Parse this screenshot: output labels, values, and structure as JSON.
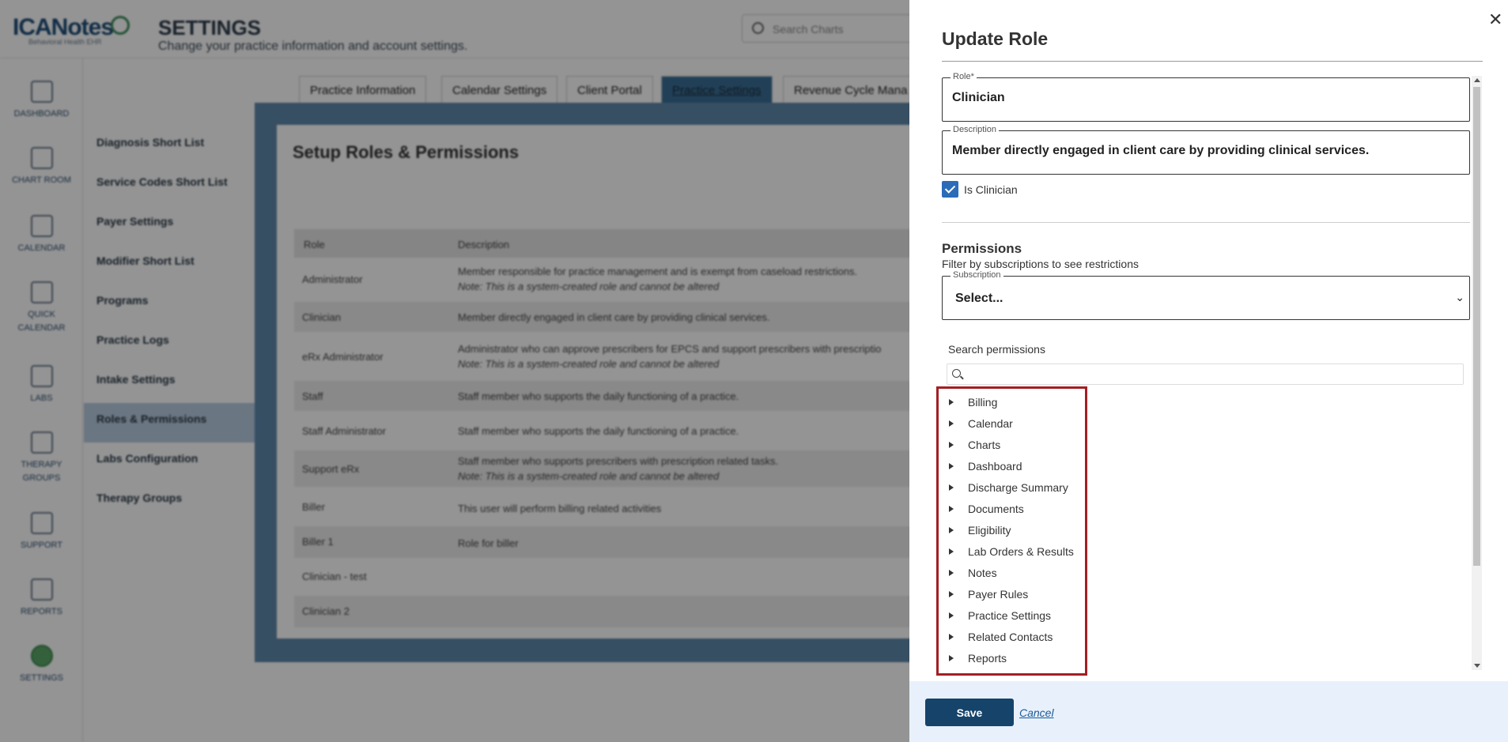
{
  "app": {
    "logo": "ICANotes",
    "logo_sub": "Behavioral Health EHR",
    "page_title": "SETTINGS",
    "page_subtitle": "Change your practice information and account settings.",
    "search_placeholder": "Search Charts"
  },
  "leftnav": [
    {
      "label": "DASHBOARD",
      "icon": "dashboard-icon"
    },
    {
      "label": "CHART ROOM",
      "icon": "chart-room-icon"
    },
    {
      "label": "CALENDAR",
      "icon": "calendar-icon"
    },
    {
      "label": "QUICK CALENDAR",
      "icon": "quick-calendar-icon"
    },
    {
      "label": "LABS",
      "icon": "flask-icon"
    },
    {
      "label": "THERAPY GROUPS",
      "icon": "group-icon"
    },
    {
      "label": "SUPPORT",
      "icon": "chat-icon"
    },
    {
      "label": "REPORTS",
      "icon": "clipboard-icon"
    },
    {
      "label": "SETTINGS",
      "icon": "gear-icon"
    }
  ],
  "subnav": [
    "Diagnosis Short List",
    "Service Codes Short List",
    "Payer Settings",
    "Modifier Short List",
    "Programs",
    "Practice Logs",
    "Intake Settings",
    "Roles & Permissions",
    "Labs Configuration",
    "Therapy Groups"
  ],
  "tabs": [
    "Practice Information",
    "Calendar Settings",
    "Client Portal",
    "Practice Settings",
    "Revenue Cycle Mana"
  ],
  "panel": {
    "title": "Setup Roles & Permissions",
    "col_role": "Role",
    "col_desc": "Description",
    "rows": [
      {
        "role": "Administrator",
        "desc": "Member responsible for practice management and is exempt from caseload restrictions.",
        "note": "Note: This is a system-created role and cannot be altered"
      },
      {
        "role": "Clinician",
        "desc": "Member directly engaged in client care by providing clinical services.",
        "note": ""
      },
      {
        "role": "eRx Administrator",
        "desc": "Administrator who can approve prescribers for EPCS and support prescribers with prescriptio",
        "note": "Note: This is a system-created role and cannot be altered"
      },
      {
        "role": "Staff",
        "desc": "Staff member who supports the daily functioning of a practice.",
        "note": ""
      },
      {
        "role": "Staff Administrator",
        "desc": "Staff member who supports the daily functioning of a practice.",
        "note": ""
      },
      {
        "role": "Support eRx",
        "desc": "Staff member who supports prescribers with prescription related tasks.",
        "note": "Note: This is a system-created role and cannot be altered"
      },
      {
        "role": "Biller",
        "desc": "This user will perform billing related activities",
        "note": ""
      },
      {
        "role": "Biller 1",
        "desc": "Role for biller",
        "note": ""
      },
      {
        "role": "Clinician - test",
        "desc": "",
        "note": ""
      },
      {
        "role": "Clinician 2",
        "desc": "",
        "note": ""
      }
    ]
  },
  "drawer": {
    "title": "Update Role",
    "role_label": "Role*",
    "role_value": "Clinician",
    "desc_label": "Description",
    "desc_value": "Member directly engaged in client care by providing clinical services.",
    "is_clinician_label": "Is Clinician",
    "is_clinician_checked": true,
    "permissions_title": "Permissions",
    "permissions_sub": "Filter by subscriptions to see restrictions",
    "subscription_label": "Subscription",
    "subscription_value": "Select...",
    "search_label": "Search permissions",
    "permissions": [
      "Billing",
      "Calendar",
      "Charts",
      "Dashboard",
      "Discharge Summary",
      "Documents",
      "Eligibility",
      "Lab Orders & Results",
      "Notes",
      "Payer Rules",
      "Practice Settings",
      "Related Contacts",
      "Reports"
    ],
    "save_label": "Save",
    "cancel_label": "Cancel",
    "highlight_color": "#a31f24",
    "primary_color": "#15436a"
  }
}
